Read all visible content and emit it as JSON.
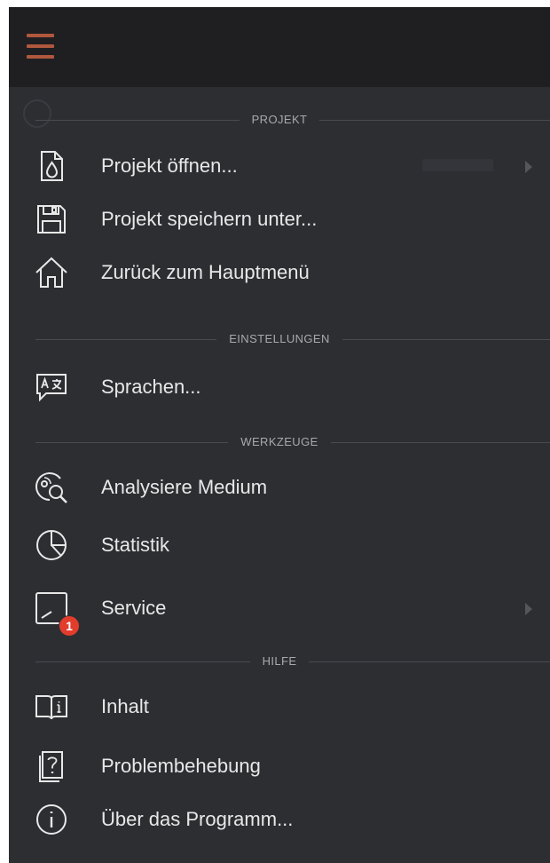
{
  "menu": {
    "sections": {
      "projekt": "PROJEKT",
      "einstellungen": "EINSTELLUNGEN",
      "werkzeuge": "WERKZEUGE",
      "hilfe": "HILFE"
    },
    "items": {
      "open_project": {
        "label": "Projekt öffnen...",
        "icon": "project-file-icon",
        "has_submenu": true
      },
      "save_project_as": {
        "label": "Projekt speichern unter...",
        "icon": "save-disk-icon"
      },
      "back_main_menu": {
        "label": "Zurück zum Hauptmenü",
        "icon": "home-icon"
      },
      "languages": {
        "label": "Sprachen...",
        "icon": "language-icon"
      },
      "analyze_medium": {
        "label": "Analysiere Medium",
        "icon": "disc-search-icon"
      },
      "statistics": {
        "label": "Statistik",
        "icon": "pie-chart-icon"
      },
      "service": {
        "label": "Service",
        "icon": "service-screen-icon",
        "has_submenu": true,
        "badge": "1"
      },
      "contents": {
        "label": "Inhalt",
        "icon": "help-book-icon"
      },
      "troubleshooting": {
        "label": "Problembehebung",
        "icon": "question-document-icon"
      },
      "about": {
        "label": "Über das Programm...",
        "icon": "info-circle-icon"
      }
    }
  },
  "colors": {
    "menu_background": "#2d2e32",
    "titlebar_background": "#1f1f21",
    "hamburger_accent": "#b0583e",
    "badge_red": "#e23c2c",
    "text": "#e8e8e8",
    "section_text": "#a8a9ad"
  }
}
